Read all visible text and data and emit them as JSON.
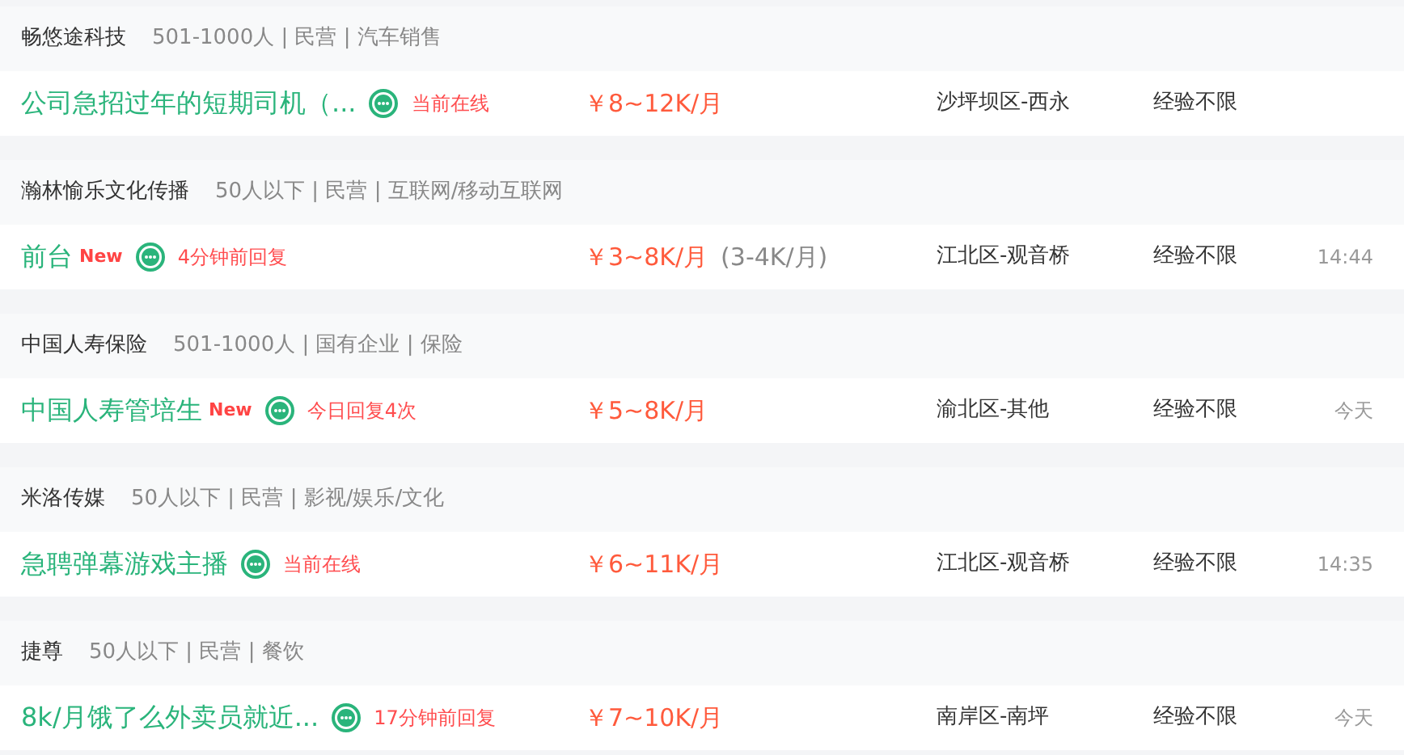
{
  "jobs": [
    {
      "company": "畅悠途科技",
      "company_info": "501-1000人 | 民营 | 汽车销售",
      "title": "公司急招过年的短期司机（...",
      "status": "当前在线",
      "salary": "￥8~12K/月",
      "location": "沙坪坝区-西永",
      "experience": "经验不限"
    },
    {
      "company": "瀚林愉乐文化传播",
      "company_info": "50人以下 | 民营 | 互联网/移动互联网",
      "title": "前台",
      "new_tag": "New",
      "status": "4分钟前回复",
      "salary": "￥3~8K/月",
      "salary_note": "(3-4K/月)",
      "location": "江北区-观音桥",
      "experience": "经验不限",
      "time": "14:44"
    },
    {
      "company": "中国人寿保险",
      "company_info": "501-1000人 | 国有企业 | 保险",
      "title": "中国人寿管培生",
      "new_tag": "New",
      "status": "今日回复4次",
      "salary": "￥5~8K/月",
      "location": "渝北区-其他",
      "experience": "经验不限",
      "time": "今天"
    },
    {
      "company": "米洛传媒",
      "company_info": "50人以下 | 民营 | 影视/娱乐/文化",
      "title": "急聘弹幕游戏主播",
      "status": "当前在线",
      "salary": "￥6~11K/月",
      "location": "江北区-观音桥",
      "experience": "经验不限",
      "time": "14:35"
    },
    {
      "company": "捷尊",
      "company_info": "50人以下 | 民营 | 餐饮",
      "title": "8k/月饿了么外卖员就近...",
      "status": "17分钟前回复",
      "salary": "￥7~10K/月",
      "location": "南岸区-南坪",
      "experience": "经验不限",
      "time": "今天"
    }
  ]
}
